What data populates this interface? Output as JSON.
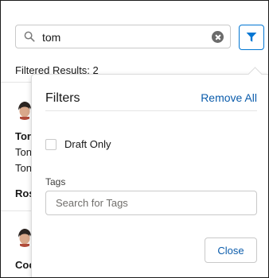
{
  "search": {
    "value": "tom"
  },
  "results_text": "Filtered Results: 2",
  "list": {
    "item1": {
      "name": "Tor",
      "line1": "Ton",
      "line2": "Ton",
      "footer": "Ros"
    },
    "item2": {
      "name": "Coc"
    }
  },
  "filters": {
    "title": "Filters",
    "remove_all_label": "Remove All",
    "draft_only_label": "Draft Only",
    "tags_label": "Tags",
    "tags_placeholder": "Search for Tags",
    "close_label": "Close"
  },
  "icons": {
    "search": "search-icon",
    "clear": "clear-icon",
    "filter": "filter-icon",
    "avatar": "avatar-icon"
  },
  "colors": {
    "brand_blue": "#0176d3",
    "link_blue": "#0b5cab",
    "border": "#c9c9c9"
  }
}
